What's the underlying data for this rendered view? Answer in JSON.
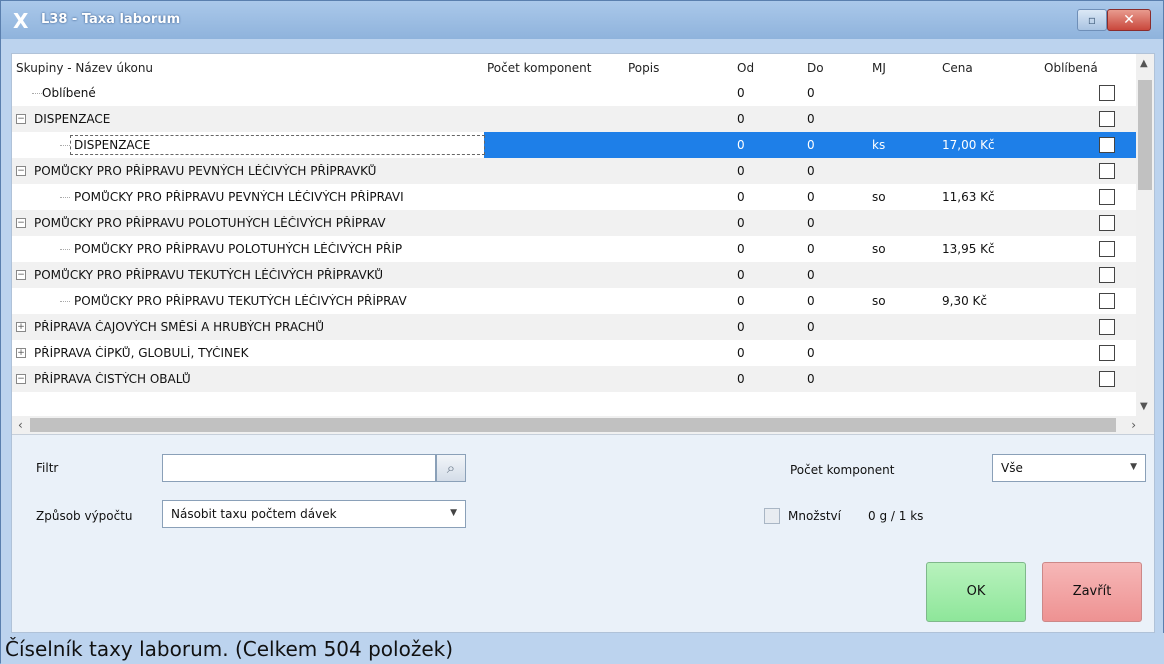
{
  "window": {
    "title": "L38 - Taxa laborum",
    "restore_glyph": "▫",
    "close_glyph": "✕",
    "app_icon": "X"
  },
  "grid": {
    "columns": {
      "name": "Skupiny - Název úkonu",
      "pocet": "Počet komponent",
      "popis": "Popis",
      "od": "Od",
      "do": "Do",
      "mj": "MJ",
      "cena": "Cena",
      "oblibena": "Oblíbená"
    },
    "rows": [
      {
        "name": "Oblíbené",
        "od": "0",
        "do": "0",
        "mj": "",
        "cena": ""
      },
      {
        "name": "DISPENZACE",
        "od": "0",
        "do": "0",
        "mj": "",
        "cena": ""
      },
      {
        "name": "DISPENZACE",
        "od": "0",
        "do": "0",
        "mj": "ks",
        "cena": "17,00 Kč"
      },
      {
        "name": "POMŮCKY PRO PŘÍPRAVU PEVNÝCH LÉČIVÝCH PŘÍPRAVKŮ",
        "od": "0",
        "do": "0",
        "mj": "",
        "cena": ""
      },
      {
        "name": "POMŮCKY PRO PŘÍPRAVU PEVNÝCH LÉČIVÝCH PŘÍPRAVI",
        "od": "0",
        "do": "0",
        "mj": "so",
        "cena": "11,63 Kč"
      },
      {
        "name": "POMŮCKY PRO PŘÍPRAVU POLOTUHÝCH LÉČIVÝCH PŘÍPRAV",
        "od": "0",
        "do": "0",
        "mj": "",
        "cena": ""
      },
      {
        "name": "POMŮCKY PRO PŘÍPRAVU POLOTUHÝCH LÉČIVÝCH PŘÍP",
        "od": "0",
        "do": "0",
        "mj": "so",
        "cena": "13,95 Kč"
      },
      {
        "name": "POMŮCKY PRO PŘÍPRAVU TEKUTÝCH LÉČIVÝCH PŘÍPRAVKŮ",
        "od": "0",
        "do": "0",
        "mj": "",
        "cena": ""
      },
      {
        "name": "POMŮCKY PRO PŘÍPRAVU TEKUTÝCH LÉČIVÝCH PŘÍPRAV",
        "od": "0",
        "do": "0",
        "mj": "so",
        "cena": "9,30 Kč"
      },
      {
        "name": "PŘÍPRAVA ČAJOVÝCH SMĚSÍ A HRUBÝCH PRACHŮ",
        "od": "0",
        "do": "0",
        "mj": "",
        "cena": ""
      },
      {
        "name": "PŘÍPRAVA ČÍPKŮ, GLOBULÍ, TYČINEK",
        "od": "0",
        "do": "0",
        "mj": "",
        "cena": ""
      },
      {
        "name": "PŘÍPRAVA ČISTÝCH OBALŮ",
        "od": "0",
        "do": "0",
        "mj": "",
        "cena": ""
      }
    ]
  },
  "filters": {
    "filtr_label": "Filtr",
    "filtr_value": "",
    "zpusob_label": "Způsob výpočtu",
    "zpusob_value": "Násobit taxu počtem dávek",
    "pocet_label": "Počet komponent",
    "pocet_value": "Vše",
    "mnozstvi_label": "Množství",
    "mnozstvi_value": "0 g / 1 ks"
  },
  "buttons": {
    "ok": "OK",
    "zavrit": "Zavřít"
  },
  "status": "Číselník taxy laborum. (Celkem 504 položek)",
  "colors": {
    "selection": "#1e7fe8",
    "ok": "#8ee69a",
    "close": "#ee9292"
  }
}
